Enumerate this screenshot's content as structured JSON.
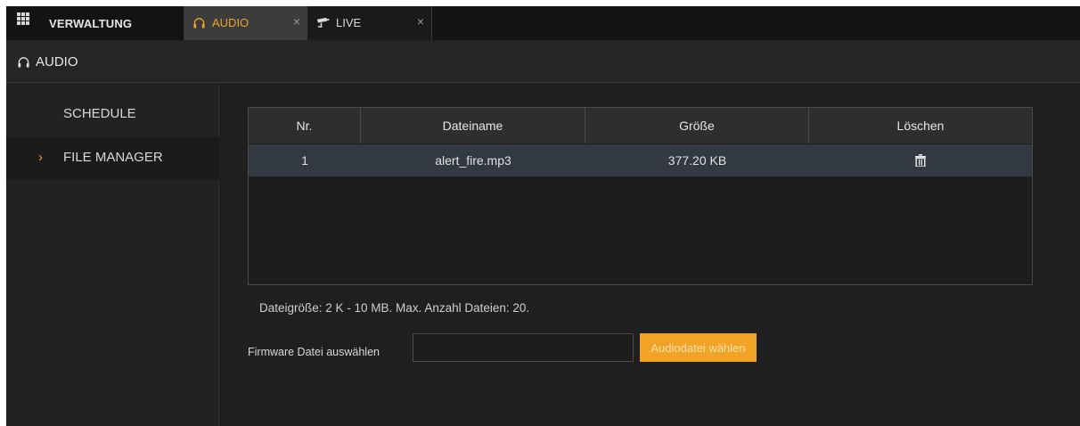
{
  "colors": {
    "accent": "#f0a324",
    "background": "#1f1f1f",
    "tabbar": "#131313",
    "selected_row": "#333942"
  },
  "tabs": {
    "home": {
      "label": "VERWALTUNG",
      "icon": "grid-icon"
    },
    "audio": {
      "label": "AUDIO",
      "icon": "headphones-icon",
      "close": "×",
      "active": true
    },
    "live": {
      "label": "LIVE",
      "icon": "camera-icon",
      "close": "×"
    }
  },
  "header": {
    "title": "AUDIO",
    "icon": "headphones-icon"
  },
  "sidebar": {
    "items": [
      {
        "label": "SCHEDULE",
        "active": false
      },
      {
        "label": "FILE MANAGER",
        "active": true,
        "chevron": "›"
      }
    ]
  },
  "table": {
    "columns": [
      "Nr.",
      "Dateiname",
      "Größe",
      "Löschen"
    ],
    "rows": [
      {
        "nr": "1",
        "filename": "alert_fire.mp3",
        "size": "377.20 KB",
        "delete_icon": "trash-icon"
      }
    ]
  },
  "info_text": "Dateigröße: 2 K - 10 MB. Max. Anzahl Dateien: 20.",
  "firmware": {
    "label": "Firmware Datei auswählen",
    "value": "",
    "button_label": "Audiodatei wählen"
  }
}
